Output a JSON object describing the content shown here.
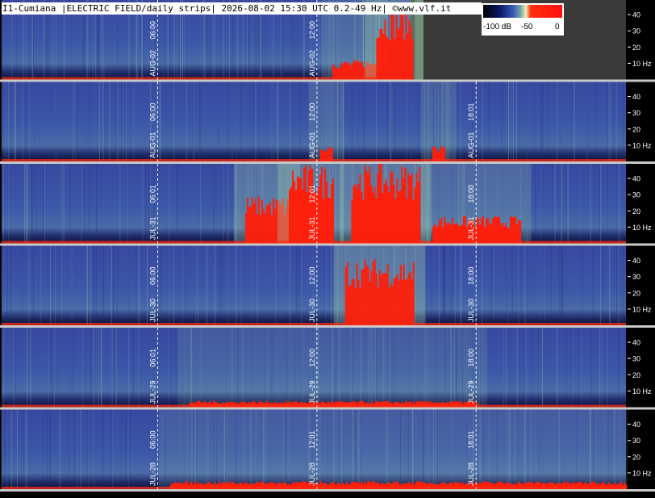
{
  "title": "I1-Cumiana |ELECTRIC FIELD/daily strips| 2026-08-02 15:30 UTC 0.2-49 Hz| ©www.vlf.it",
  "colorbar": {
    "labels": [
      "-100 dB",
      "-50",
      "0"
    ],
    "colors": [
      "#000000",
      "#0a1a6a",
      "#3a5ab8",
      "#7ab0a0",
      "#f0f0c0",
      "#ff2010"
    ]
  },
  "chart_data": {
    "type": "heatmap",
    "title": "I1-Cumiana |ELECTRIC FIELD/daily strips| 2026-08-02 15:30 UTC 0.2-49 Hz| ©www.vlf.it",
    "y_axis": {
      "ticks": [
        "40",
        "30",
        "20",
        "10 Hz"
      ],
      "ylim": [
        0.2,
        49
      ],
      "unit": "Hz"
    },
    "strips": [
      {
        "date": "AUG-02",
        "markers": [
          "06:00",
          "12:00"
        ],
        "partial": true,
        "red_bursts": [
          [
            0.53,
            0.6,
            0.25
          ],
          [
            0.6,
            0.68,
            0.9
          ],
          [
            0.68,
            0.84,
            1.0
          ]
        ]
      },
      {
        "date": "AUG-01",
        "markers": [
          "06:00",
          "12:00",
          "18:01"
        ],
        "partial": false,
        "red_bursts": [
          [
            0.51,
            0.53,
            0.2
          ],
          [
            0.69,
            0.71,
            0.2
          ]
        ]
      },
      {
        "date": "JUL-31",
        "markers": [
          "06:01",
          "12:01",
          "18:00"
        ],
        "partial": false,
        "red_bursts": [
          [
            0.39,
            0.46,
            0.6
          ],
          [
            0.46,
            0.53,
            1.0
          ],
          [
            0.56,
            0.67,
            1.0
          ],
          [
            0.69,
            0.83,
            0.35
          ]
        ]
      },
      {
        "date": "JUL-30",
        "markers": [
          "06:00",
          "12:00",
          "18:00"
        ],
        "partial": false,
        "red_bursts": [
          [
            0.55,
            0.66,
            0.85
          ]
        ]
      },
      {
        "date": "JUL-29",
        "markers": [
          "06:01",
          "12:00",
          "18:00"
        ],
        "partial": false,
        "red_bursts": [
          [
            0.3,
            0.76,
            0.08
          ]
        ]
      },
      {
        "date": "JUL-28",
        "markers": [
          "06:00",
          "12:01",
          "18:01"
        ],
        "partial": false,
        "red_bursts": [
          [
            0.27,
            1.0,
            0.1
          ]
        ]
      }
    ],
    "xlabel": "",
    "ylabel": ""
  }
}
